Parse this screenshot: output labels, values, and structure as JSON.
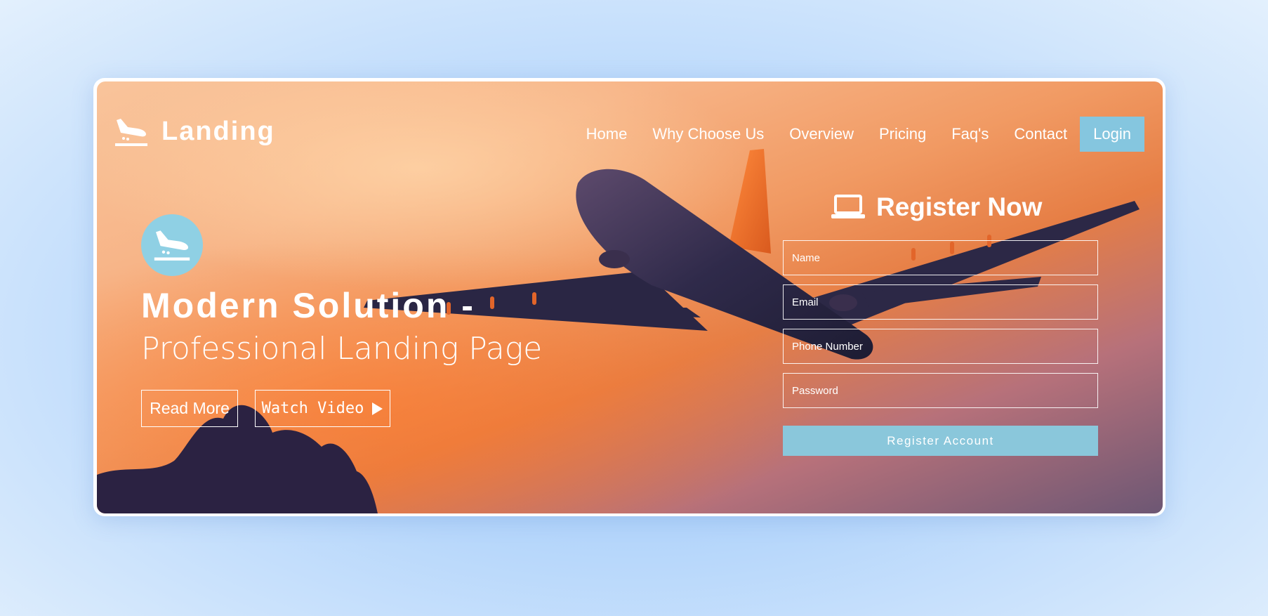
{
  "brand": {
    "name": "Landing",
    "icon": "plane-landing-icon"
  },
  "nav": {
    "items": [
      "Home",
      "Why Choose Us",
      "Overview",
      "Pricing",
      "Faq's",
      "Contact"
    ],
    "login_label": "Login"
  },
  "hero": {
    "badge_icon": "plane-landing-icon",
    "headline": "Modern Solution -",
    "subline": "Professional Landing Page",
    "read_more_label": "Read More",
    "watch_video_label": "Watch Video",
    "watch_video_icon": "play-icon"
  },
  "register": {
    "icon": "laptop-icon",
    "title": "Register Now",
    "name_placeholder": "Name",
    "email_placeholder": "Email",
    "phone_placeholder": "Phone Number",
    "password_placeholder": "Password",
    "submit_label": "Register Account"
  },
  "colors": {
    "accent": "#85c6df",
    "badge": "#8fd0e4",
    "text": "#ffffff"
  }
}
